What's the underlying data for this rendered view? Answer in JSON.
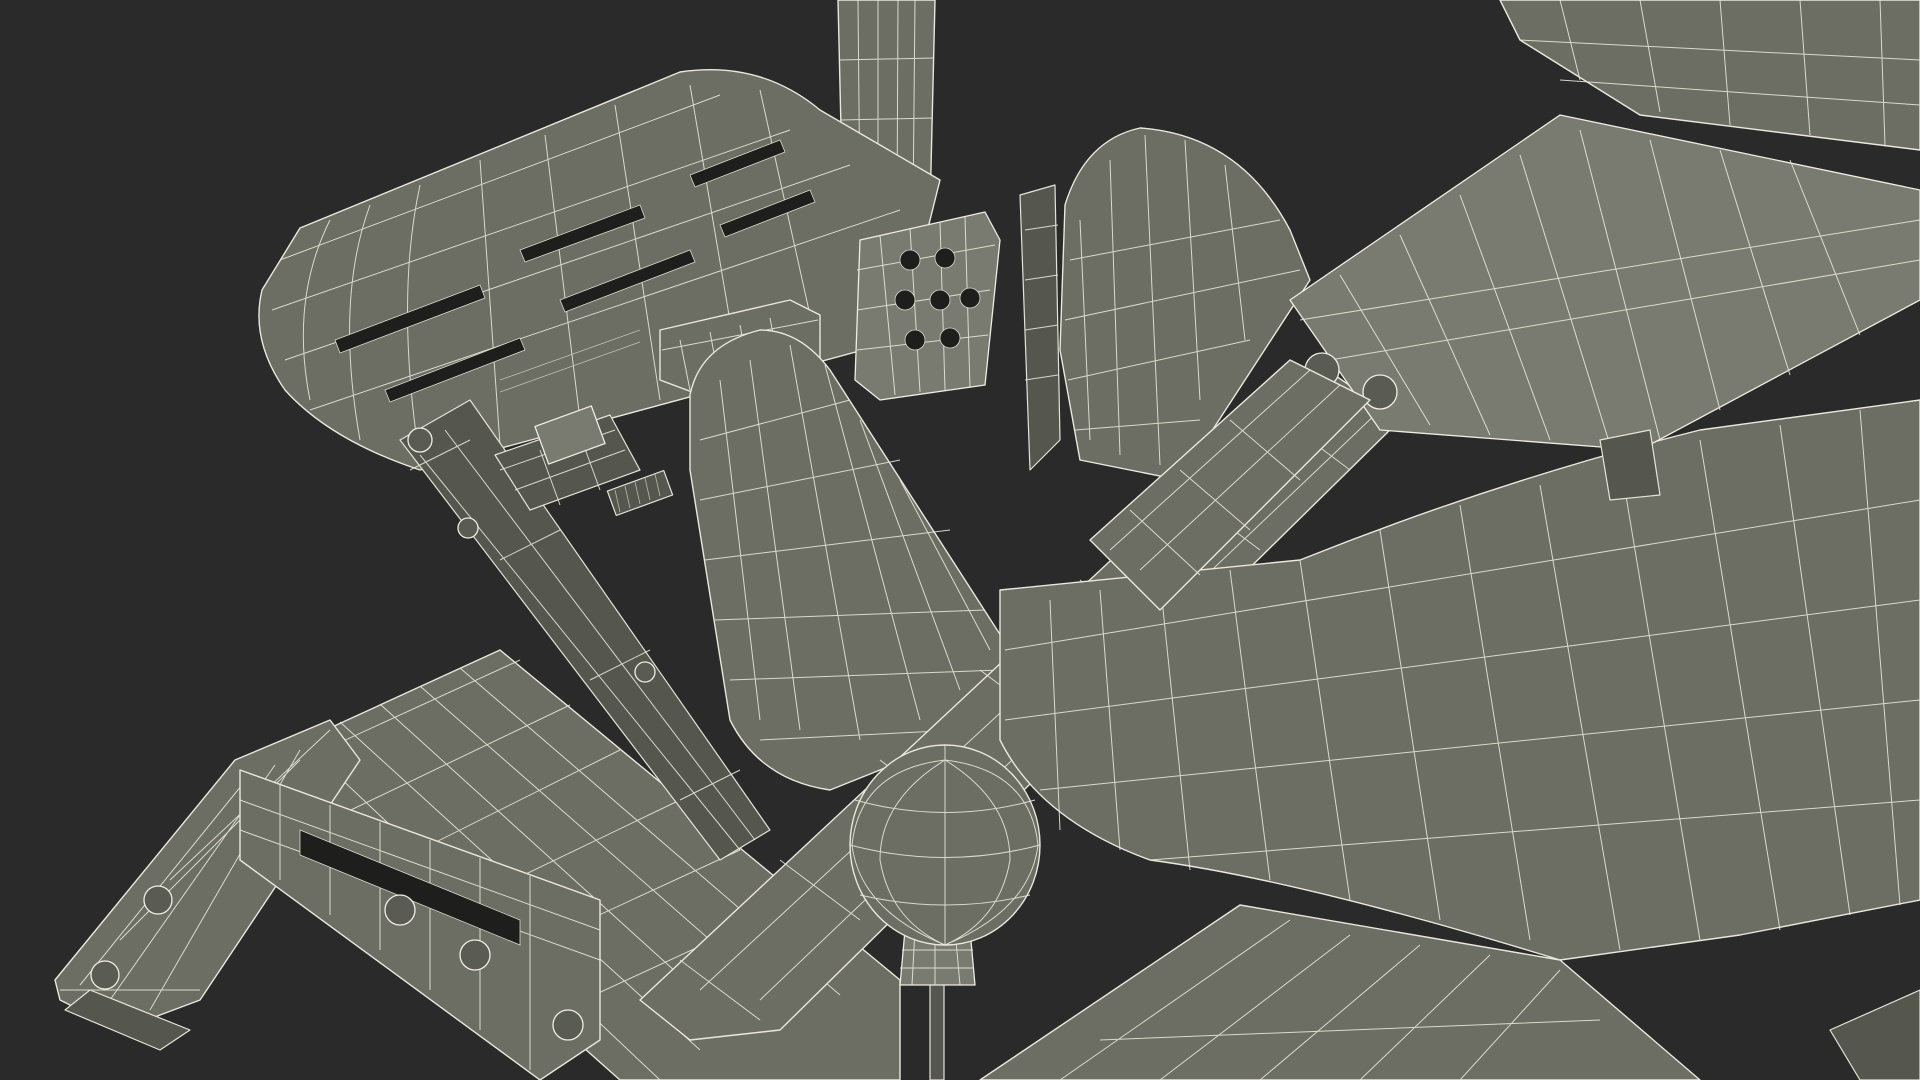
{
  "scene": {
    "background_color": "#2a2a2a",
    "mesh_fill_color": "#6c6d63",
    "wire_color": "#e9e8dc"
  }
}
